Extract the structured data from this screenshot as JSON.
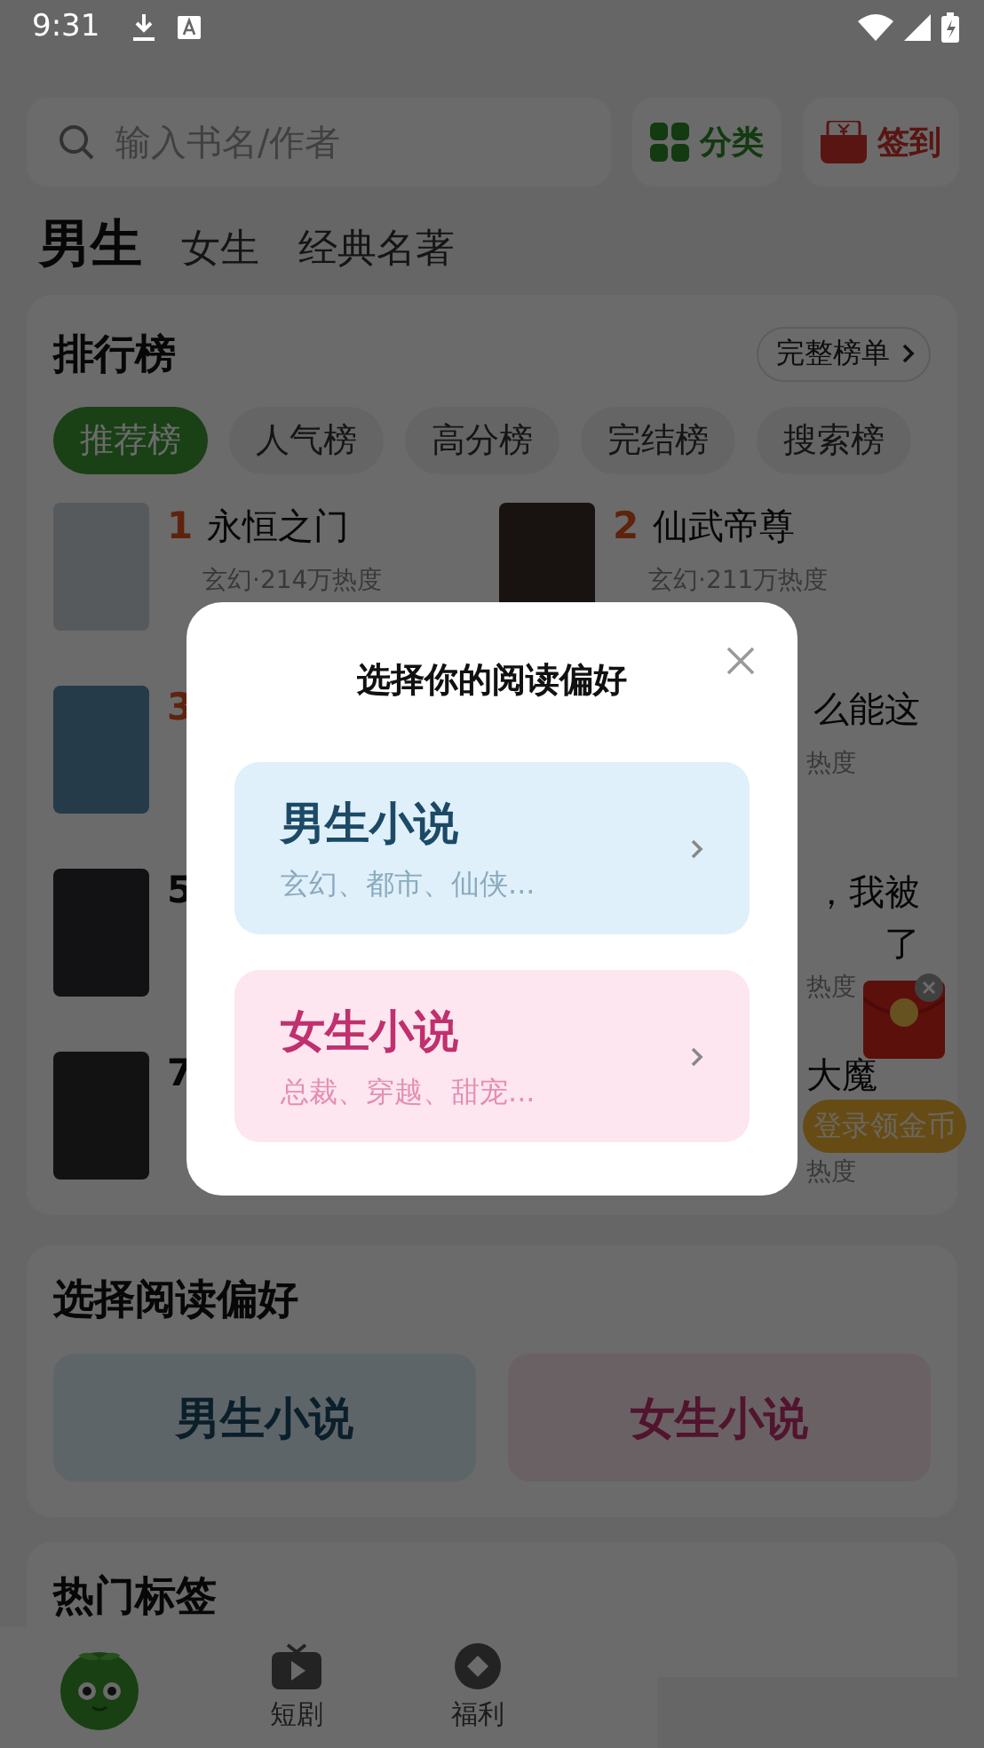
{
  "status_bar": {
    "time": "9:31"
  },
  "search": {
    "placeholder": "输入书名/作者"
  },
  "header_buttons": [
    {
      "kind": "category",
      "label": "分类"
    },
    {
      "kind": "checkin",
      "label": "签到"
    }
  ],
  "channel_tabs": [
    {
      "label": "男生",
      "selected": true
    },
    {
      "label": "女生",
      "selected": false
    },
    {
      "label": "经典名著",
      "selected": false
    }
  ],
  "ranking": {
    "title": "排行榜",
    "more": "完整榜单",
    "filters": [
      {
        "label": "推荐榜",
        "selected": true
      },
      {
        "label": "人气榜",
        "selected": false
      },
      {
        "label": "高分榜",
        "selected": false
      },
      {
        "label": "完结榜",
        "selected": false
      },
      {
        "label": "搜索榜",
        "selected": false
      }
    ],
    "books": [
      {
        "kind": "full",
        "rank": "1",
        "title": "永恒之门",
        "meta": "玄幻·214万热度"
      },
      {
        "kind": "full",
        "rank": "2",
        "title": "仙武帝尊",
        "meta": "玄幻·211万热度"
      },
      {
        "kind": "cover",
        "rank": "3"
      },
      {
        "kind": "partial",
        "title": "么能这",
        "meta": "热度"
      },
      {
        "kind": "cover",
        "rank": "5"
      },
      {
        "kind": "partial",
        "title": "，我被",
        "title_2": "了",
        "meta": "热度"
      },
      {
        "kind": "cover",
        "rank": "7"
      },
      {
        "kind": "partial",
        "title": "大魔",
        "meta": "热度"
      }
    ]
  },
  "preference": {
    "title": "选择阅读偏好",
    "options": [
      {
        "kind": "male",
        "label": "男生小说"
      },
      {
        "kind": "female",
        "label": "女生小说"
      }
    ]
  },
  "hot_tags": {
    "title": "热门标签"
  },
  "bottom_nav": [
    {
      "kind": "logo"
    },
    {
      "kind": "drama",
      "label": "短剧"
    },
    {
      "kind": "welfare",
      "label": "福利"
    }
  ],
  "float_reward": {
    "label": "登录领金币"
  },
  "modal": {
    "title": "选择你的阅读偏好",
    "options": [
      {
        "kind": "male",
        "title": "男生小说",
        "subtitle": "玄幻、都市、仙侠..."
      },
      {
        "kind": "female",
        "title": "女生小说",
        "subtitle": "总裁、穿越、甜宠..."
      }
    ]
  }
}
